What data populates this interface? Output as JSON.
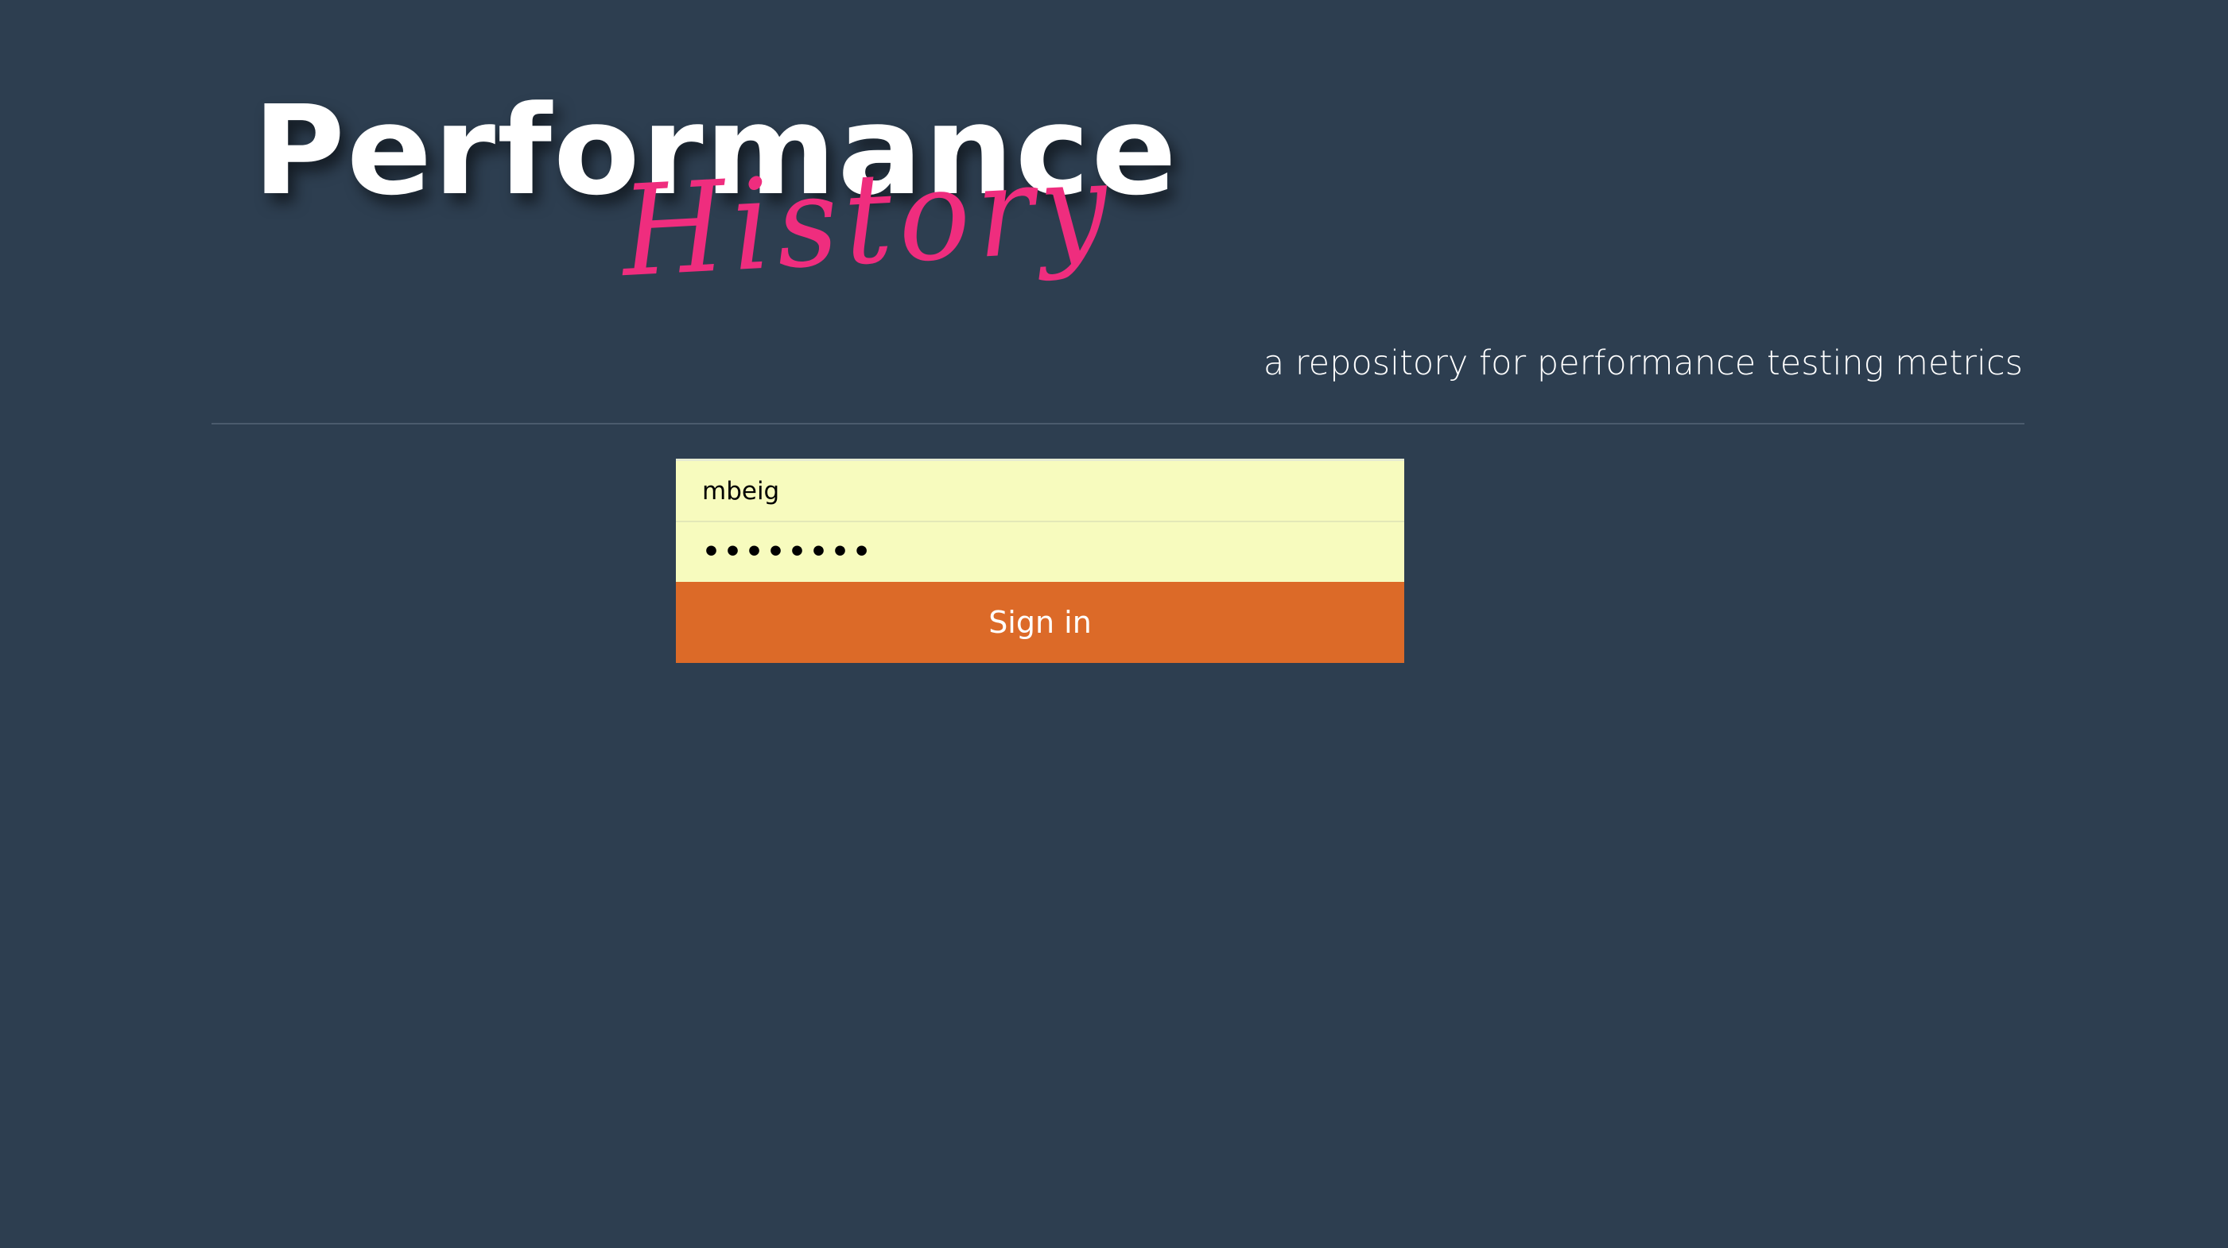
{
  "logo": {
    "main": "Performance",
    "script": "History"
  },
  "tagline": "a repository for performance testing metrics",
  "login": {
    "username_value": "mbeig",
    "password_mask": "••••••••",
    "signin_label": "Sign in"
  },
  "colors": {
    "background": "#2d3e50",
    "accent_pink": "#ef2d7e",
    "input_bg": "#f7fbbe",
    "button_bg": "#dc6a28"
  }
}
